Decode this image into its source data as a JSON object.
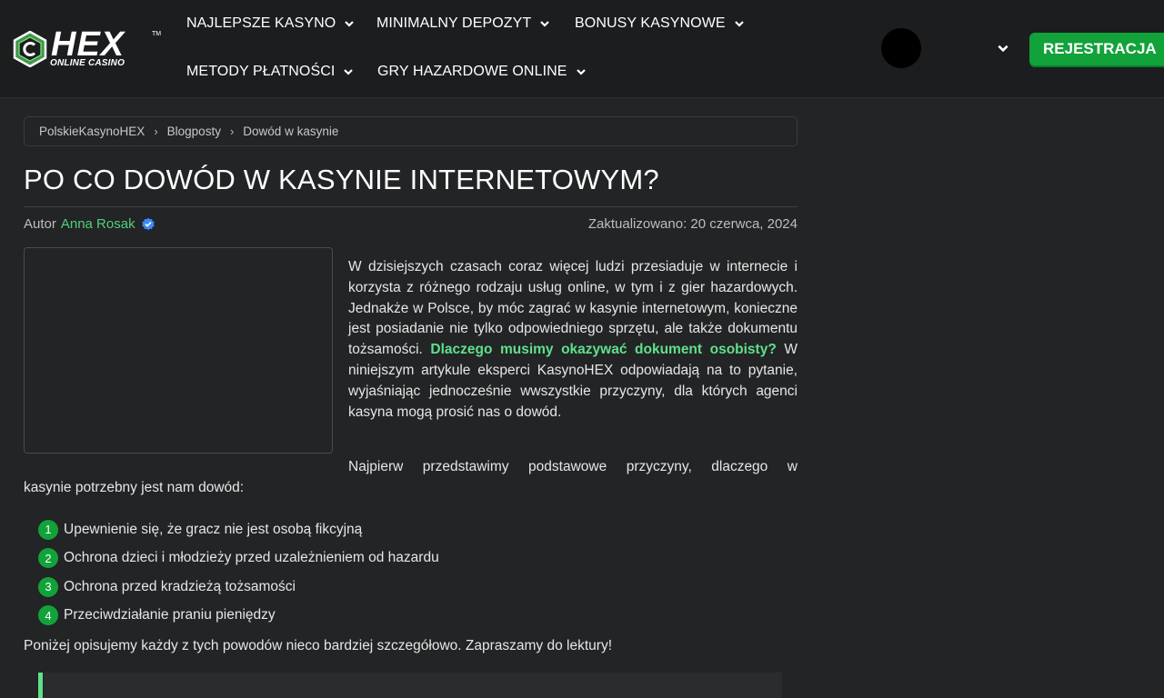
{
  "brand": {
    "name": "HEX",
    "tagline": "ONLINE CASINO",
    "trademark": "TM"
  },
  "nav": {
    "items": [
      {
        "label": "NAJLEPSZE KASYNO",
        "icon": "chevron-down-icon"
      },
      {
        "label": "MINIMALNY DEPOZYT",
        "icon": "chevron-down-icon"
      },
      {
        "label": "BONUSY KASYNOWE",
        "icon": "chevron-down-icon"
      },
      {
        "label": "METODY PŁATNOŚCI",
        "icon": "chevron-down-icon"
      },
      {
        "label": "GRY HAZARDOWE ONLINE",
        "icon": "chevron-down-icon"
      }
    ],
    "register_label": "REJESTRACJA"
  },
  "breadcrumb": [
    "PolskieKasynoHEX",
    "Blogposty",
    "Dowód w kasynie"
  ],
  "article": {
    "title": "PO CO DOWÓD W KASYNIE INTERNETOWYM?",
    "author_prefix": "Autor",
    "author_name": "Anna Rosak",
    "updated": "Zaktualizowano: 20 czerwca, 2024",
    "intro_before": "W dzisiejszych czasach coraz więcej ludzi przesiaduje w internecie i korzysta z różnego rodzaju usług online, w tym i z gier hazardowych. Jednakże w Polsce, by móc zagrać w kasynie internetowym, konieczne jest posiadanie nie tylko odpowiedniego sprzętu, ale także dokumentu tożsamości.",
    "intro_highlight": "Dlaczego musimy okazywać dokument osobisty?",
    "intro_after": "W niniejszym artykule eksperci KasynoHEX odpowiadają na to pytanie, wyjaśniając jednocześnie wwszystkie przyczyny, dla których agenci kasyna mogą prosić nas o dowód.",
    "p2_line1": "Najpierw przedstawimy podstawowe przyczyny, dlaczego w",
    "p2_line2": "kasynie potrzebny jest nam dowód:",
    "list": [
      {
        "num": "1",
        "text": "Upewnienie się, że gracz nie jest osobą fikcyjną"
      },
      {
        "num": "2",
        "text": "Ochrona dzieci i młodzieży przed uzależnieniem od hazardu"
      },
      {
        "num": "3",
        "text": "Ochrona przed kradzieżą tożsamości"
      },
      {
        "num": "4",
        "text": "Przeciwdziałanie praniu pieniędzy"
      }
    ],
    "p3": "Poniżej opisujemy każdy z tych powodów nieco bardziej szczegółowo. Zapraszamy do lektury!"
  },
  "colors": {
    "header_bg": "#1c1d1f",
    "page_bg": "#232425",
    "accent_green": "#12a23a",
    "link_green": "#4ed17a",
    "highlight_green": "#5fe08b",
    "verified_blue": "#3d8bfd"
  }
}
